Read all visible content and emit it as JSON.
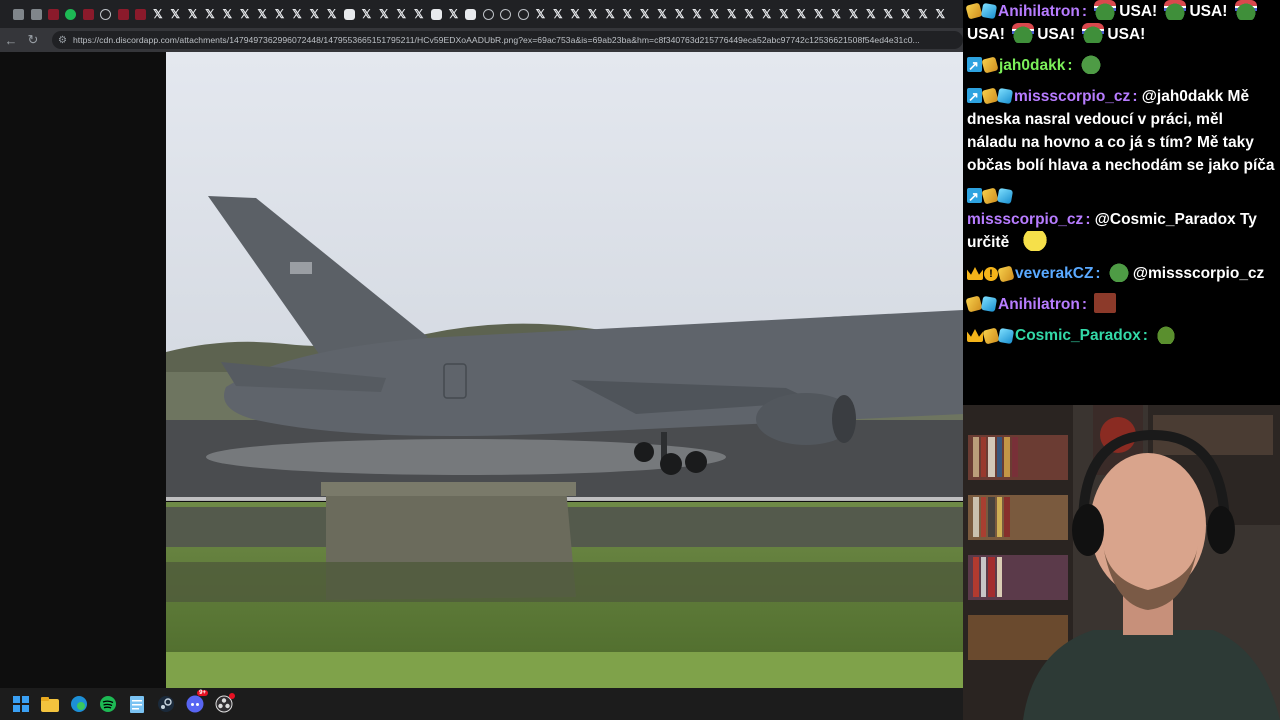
{
  "browser": {
    "tabs": [
      "gray",
      "gray",
      "red",
      "green",
      "red",
      "globe",
      "red",
      "red",
      "x",
      "x",
      "x",
      "x",
      "x",
      "x",
      "x",
      "x",
      "x",
      "x",
      "x",
      "cyan",
      "x",
      "x",
      "x",
      "x",
      "cyan",
      "x",
      "cyan",
      "globe",
      "globe",
      "globe",
      "x",
      "x",
      "x",
      "x",
      "x",
      "x",
      "x",
      "x",
      "x",
      "x",
      "x",
      "x",
      "x",
      "x",
      "x",
      "x",
      "x",
      "x",
      "x",
      "x",
      "x",
      "x",
      "x",
      "x"
    ],
    "nav": {
      "back_icon": "arrow-left-icon",
      "reload_icon": "reload-icon",
      "tune_icon": "site-info-icon"
    },
    "url": "https://cdn.discordapp.com/attachments/1479497362996072448/1479553665151795211/HCv59EDXoAADUbR.png?ex=69ac753a&is=69ab23ba&hm=c8f340763d215776449eca52abc97742c12536621508f54ed4e31c0..."
  },
  "taskbar": {
    "icons": [
      "windows-start-icon",
      "file-explorer-icon",
      "edge-icon",
      "spotify-icon",
      "notepad-icon",
      "steam-icon",
      "discord-icon",
      "obs-icon"
    ],
    "discord_badge": "9+"
  },
  "chat": {
    "messages": [
      {
        "badges": [
          "sub",
          "cube"
        ],
        "name": "Anihilatron",
        "color": "#b77cff",
        "parts": [
          {
            "emote": "pepe-usa"
          },
          {
            "text": "USA!"
          },
          {
            "emote": "pepe-usa"
          },
          {
            "text": "USA!"
          },
          {
            "emote": "pepe-usa"
          },
          {
            "text": "USA!"
          },
          {
            "emote": "pepe-usa"
          },
          {
            "text": "USA!"
          },
          {
            "emote": "pepe-usa"
          },
          {
            "text": "USA!"
          }
        ]
      },
      {
        "badges": [
          "arrow",
          "sub"
        ],
        "name": "jah0dakk",
        "color": "#7cf05a",
        "parts": [
          {
            "emote": "pepe"
          }
        ]
      },
      {
        "badges": [
          "arrow",
          "sub",
          "cube"
        ],
        "name": "missscorpio_cz",
        "color": "#b77cff",
        "parts": [
          {
            "text": "@jah0dakk Mě dneska nasral vedoucí v práci, měl náladu na hovno a co já s tím? Mě taky občas bolí hlava a nechodám se jako píča"
          }
        ]
      },
      {
        "badges": [
          "arrow",
          "sub",
          "cube"
        ],
        "name": "missscorpio_cz",
        "color": "#b77cff",
        "break_after_badges": true,
        "parts": [
          {
            "text": "@Cosmic_Paradox Ty určitě"
          },
          {
            "emote": "minion"
          }
        ]
      },
      {
        "badges": [
          "crown",
          "excl",
          "sub"
        ],
        "name": "veverakCZ",
        "color": "#5aa9ff",
        "parts": [
          {
            "emote": "pepe"
          },
          {
            "text": "@missscorpio_cz"
          }
        ]
      },
      {
        "badges": [
          "sub",
          "cube"
        ],
        "name": "Anihilatron",
        "color": "#b77cff",
        "parts": [
          {
            "emote": "red"
          }
        ]
      },
      {
        "badges": [
          "crown",
          "sub",
          "cube"
        ],
        "name": "Cosmic_Paradox",
        "color": "#33d9a8",
        "parts": [
          {
            "emote": "frog"
          }
        ]
      }
    ]
  }
}
